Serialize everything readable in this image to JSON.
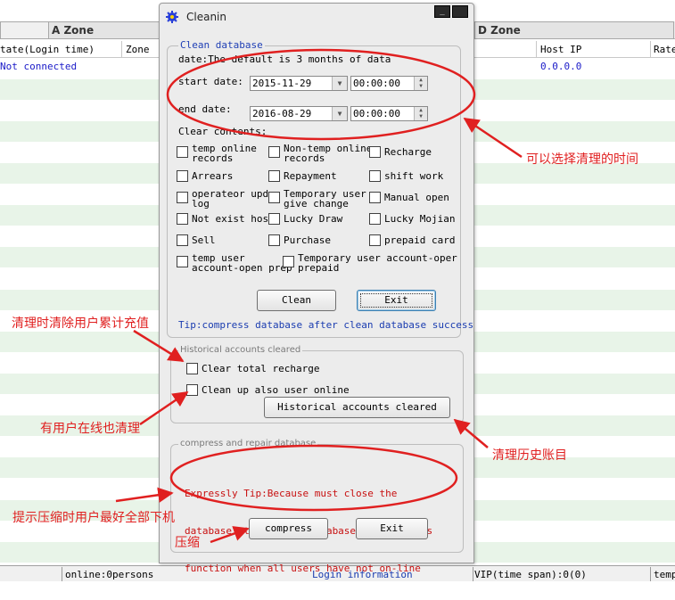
{
  "main_window": {
    "zones": [
      "A Zone",
      "D Zone"
    ],
    "columns": [
      "tate(Login time)",
      "Zone",
      "Host IP",
      "Rate"
    ],
    "first_row": {
      "status": "Not connected",
      "host_ip": "0.0.0.0"
    },
    "statusbar": {
      "online": "online:0persons",
      "login_info": "Login information",
      "vip": "VIP(time span):0(0)",
      "temp": "temp"
    }
  },
  "dialog": {
    "title": "Cleanin",
    "clean_database": {
      "legend": "Clean database",
      "note": "date:The default is 3 months of data",
      "start_label": "start date:",
      "start_date": "2015-11-29",
      "start_time": "00:00:00",
      "end_label": "end date:",
      "end_date": "2016-08-29",
      "end_time": "00:00:00",
      "contents_label": "Clear contents:",
      "options": [
        [
          "temp online",
          "records"
        ],
        [
          "Non-temp online",
          "records"
        ],
        [
          "Recharge"
        ],
        [
          "Arrears"
        ],
        [
          "Repayment"
        ],
        [
          "shift work"
        ],
        [
          "operateor upda",
          "log"
        ],
        [
          "Temporary user",
          "give change"
        ],
        [
          "Manual open"
        ],
        [
          "Not exist host"
        ],
        [
          "Lucky Draw"
        ],
        [
          "Lucky Mojian"
        ],
        [
          "Sell"
        ],
        [
          "Purchase"
        ],
        [
          "prepaid card"
        ],
        [
          "temp user",
          "account-open prep"
        ],
        [
          "Temporary user account-oper",
          "prepaid"
        ]
      ],
      "clean_button": "Clean",
      "exit_button": "Exit",
      "tip": "Tip:compress database after clean database success"
    },
    "historical": {
      "legend": "Historical accounts cleared",
      "clear_total_recharge": "Clear total recharge",
      "clean_up_online": "Clean up also user online",
      "button": "Historical accounts cleared"
    },
    "compress": {
      "legend": "compress and repair database",
      "tip_lines": [
        "Expressly Tip:Because must close the",
        "database at compress database, so use this",
        "function when all users have not on-line"
      ],
      "compress_button": "compress",
      "exit_button": "Exit"
    }
  },
  "annotations": {
    "time": "可以选择清理的时间",
    "clear_recharge": "清理时清除用户累计充值",
    "online": "有用户在线也清理",
    "history": "清理历史账目",
    "compress_tip": "提示压缩时用户最好全部下机",
    "compress": "压缩"
  },
  "colors": {
    "annotation_red": "#e02020",
    "tip_blue": "#1a3cb0",
    "alt_row_green": "#e8f4e8"
  }
}
